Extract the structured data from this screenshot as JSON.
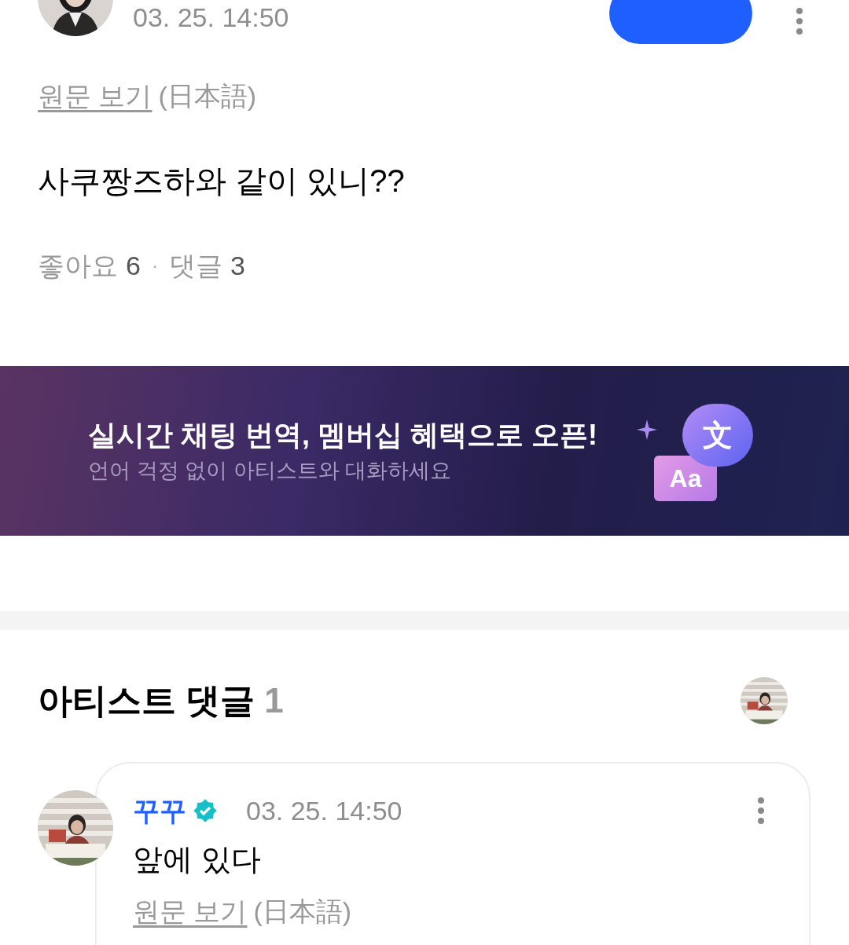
{
  "post": {
    "date": "03. 25. 14:50",
    "translation_link": "원문 보기",
    "original_language": "(日本語)",
    "text": "사쿠짱즈하와 같이 있니??",
    "likes_label": "좋아요",
    "likes": "6",
    "separator": "·",
    "comments_label": "댓글",
    "comments": "3"
  },
  "banner": {
    "title": "실시간 채팅 번역, 멤버십 혜택으로 오픈!",
    "subtitle": "언어 걱정 없이 아티스트와 대화하세요",
    "icon_glyph": "文",
    "icon_letters": "Aa"
  },
  "artist_comments": {
    "title": "아티스트 댓글",
    "count": "1",
    "comments": [
      {
        "author": "꾸꾸",
        "verified": true,
        "date": "03. 25. 14:50",
        "text": "앞에 있다",
        "translation_link": "원문 보기",
        "original_language": "(日本語)"
      }
    ]
  }
}
